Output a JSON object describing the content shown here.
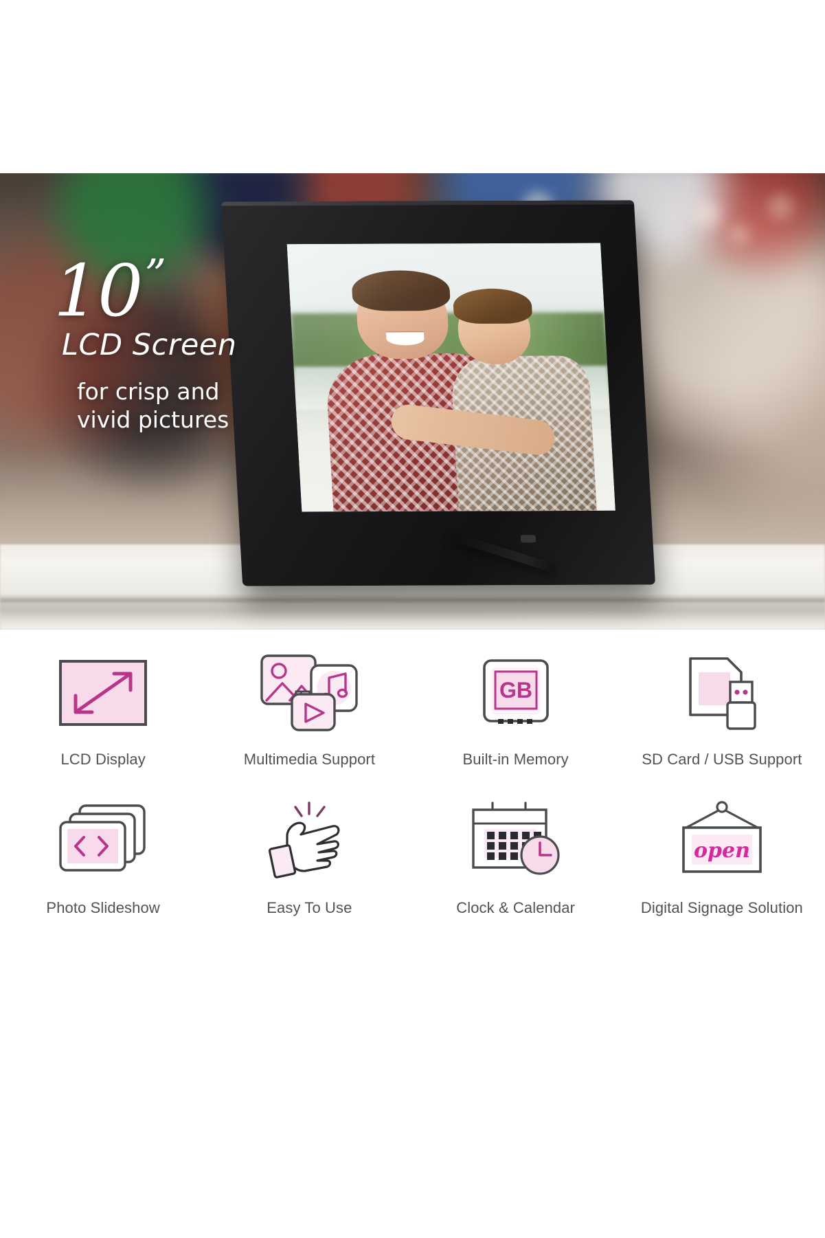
{
  "hero": {
    "size_number": "10",
    "size_unit": "”",
    "headline": "LCD Screen",
    "subtext_line1": "for crisp and",
    "subtext_line2": "vivid pictures"
  },
  "product": {
    "name": "digital-photo-frame",
    "frame_color": "#1b1b1d",
    "photo_caption": "man and boy outdoors"
  },
  "colors": {
    "accent_pink_fill": "#f7dbeb",
    "accent_magenta": "#b7368c",
    "icon_outline": "#4a4a4f",
    "label_text": "#4f5256",
    "page_background": "#ffffff"
  },
  "features": {
    "row1": [
      {
        "icon": "lcd-display-icon",
        "label": "LCD Display"
      },
      {
        "icon": "multimedia-support-icon",
        "label": "Multimedia Support"
      },
      {
        "icon": "built-in-memory-icon",
        "label": "Built-in Memory",
        "chip_text": "GB"
      },
      {
        "icon": "sd-card-usb-icon",
        "label": "SD Card / USB Support"
      }
    ],
    "row2": [
      {
        "icon": "photo-slideshow-icon",
        "label": "Photo Slideshow"
      },
      {
        "icon": "easy-to-use-icon",
        "label": "Easy To Use"
      },
      {
        "icon": "clock-calendar-icon",
        "label": "Clock & Calendar"
      },
      {
        "icon": "digital-signage-icon",
        "label": "Digital Signage Solution",
        "sign_text": "open"
      }
    ]
  }
}
